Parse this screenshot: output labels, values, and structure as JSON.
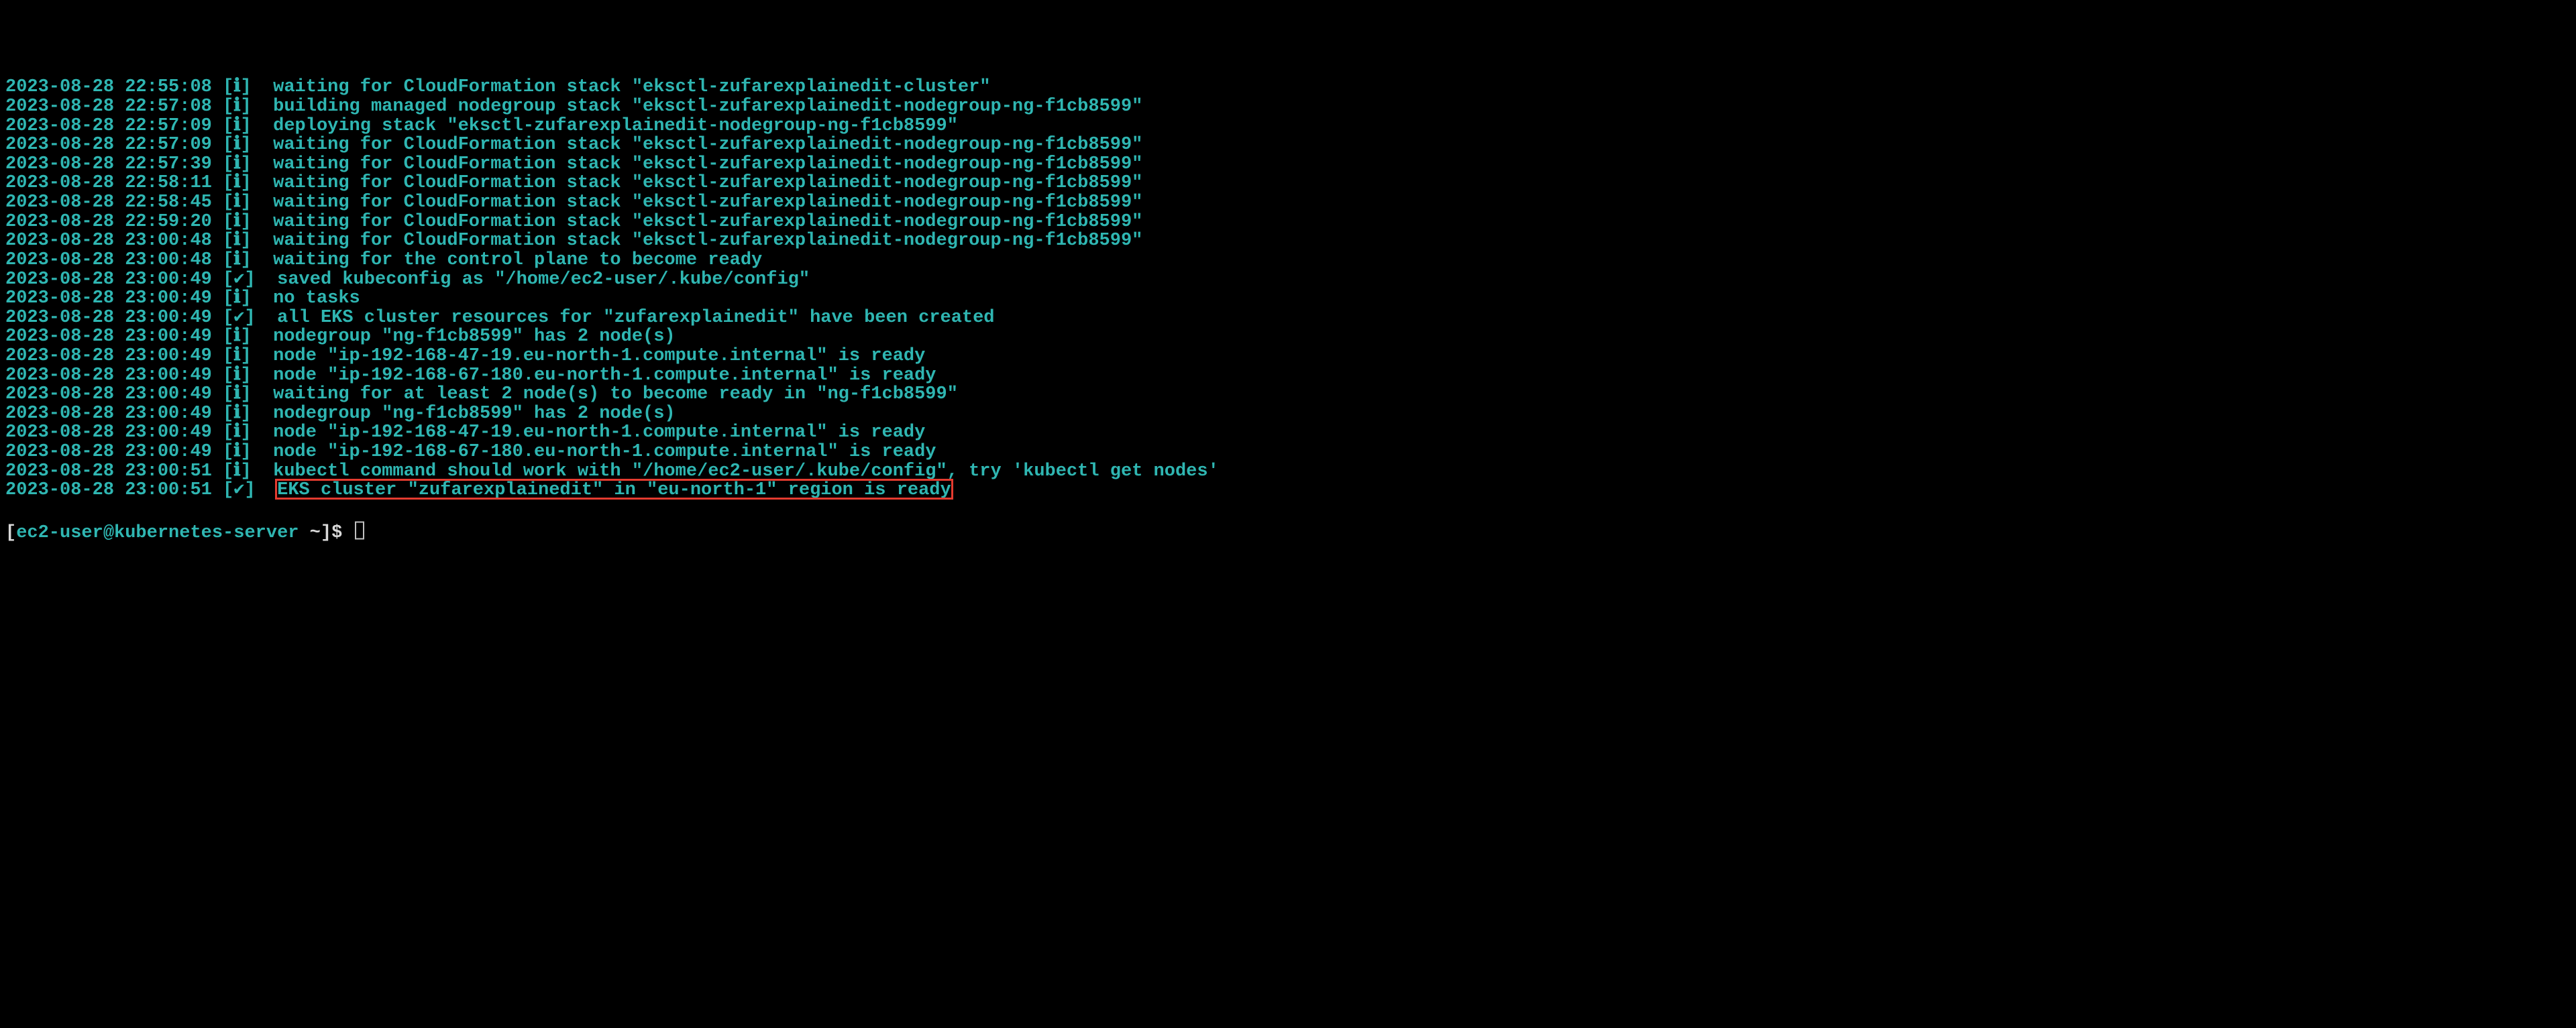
{
  "lines": [
    {
      "timestamp": "2023-08-28 22:55:08",
      "flag": "[ℹ]",
      "message": "waiting for CloudFormation stack \"eksctl-zufarexplainedit-cluster\""
    },
    {
      "timestamp": "2023-08-28 22:57:08",
      "flag": "[ℹ]",
      "message": "building managed nodegroup stack \"eksctl-zufarexplainedit-nodegroup-ng-f1cb8599\""
    },
    {
      "timestamp": "2023-08-28 22:57:09",
      "flag": "[ℹ]",
      "message": "deploying stack \"eksctl-zufarexplainedit-nodegroup-ng-f1cb8599\""
    },
    {
      "timestamp": "2023-08-28 22:57:09",
      "flag": "[ℹ]",
      "message": "waiting for CloudFormation stack \"eksctl-zufarexplainedit-nodegroup-ng-f1cb8599\""
    },
    {
      "timestamp": "2023-08-28 22:57:39",
      "flag": "[ℹ]",
      "message": "waiting for CloudFormation stack \"eksctl-zufarexplainedit-nodegroup-ng-f1cb8599\""
    },
    {
      "timestamp": "2023-08-28 22:58:11",
      "flag": "[ℹ]",
      "message": "waiting for CloudFormation stack \"eksctl-zufarexplainedit-nodegroup-ng-f1cb8599\""
    },
    {
      "timestamp": "2023-08-28 22:58:45",
      "flag": "[ℹ]",
      "message": "waiting for CloudFormation stack \"eksctl-zufarexplainedit-nodegroup-ng-f1cb8599\""
    },
    {
      "timestamp": "2023-08-28 22:59:20",
      "flag": "[ℹ]",
      "message": "waiting for CloudFormation stack \"eksctl-zufarexplainedit-nodegroup-ng-f1cb8599\""
    },
    {
      "timestamp": "2023-08-28 23:00:48",
      "flag": "[ℹ]",
      "message": "waiting for CloudFormation stack \"eksctl-zufarexplainedit-nodegroup-ng-f1cb8599\""
    },
    {
      "timestamp": "2023-08-28 23:00:48",
      "flag": "[ℹ]",
      "message": "waiting for the control plane to become ready"
    },
    {
      "timestamp": "2023-08-28 23:00:49",
      "flag": "[✔]",
      "message": "saved kubeconfig as \"/home/ec2-user/.kube/config\""
    },
    {
      "timestamp": "2023-08-28 23:00:49",
      "flag": "[ℹ]",
      "message": "no tasks"
    },
    {
      "timestamp": "2023-08-28 23:00:49",
      "flag": "[✔]",
      "message": "all EKS cluster resources for \"zufarexplainedit\" have been created"
    },
    {
      "timestamp": "2023-08-28 23:00:49",
      "flag": "[ℹ]",
      "message": "nodegroup \"ng-f1cb8599\" has 2 node(s)"
    },
    {
      "timestamp": "2023-08-28 23:00:49",
      "flag": "[ℹ]",
      "message": "node \"ip-192-168-47-19.eu-north-1.compute.internal\" is ready"
    },
    {
      "timestamp": "2023-08-28 23:00:49",
      "flag": "[ℹ]",
      "message": "node \"ip-192-168-67-180.eu-north-1.compute.internal\" is ready"
    },
    {
      "timestamp": "2023-08-28 23:00:49",
      "flag": "[ℹ]",
      "message": "waiting for at least 2 node(s) to become ready in \"ng-f1cb8599\""
    },
    {
      "timestamp": "2023-08-28 23:00:49",
      "flag": "[ℹ]",
      "message": "nodegroup \"ng-f1cb8599\" has 2 node(s)"
    },
    {
      "timestamp": "2023-08-28 23:00:49",
      "flag": "[ℹ]",
      "message": "node \"ip-192-168-47-19.eu-north-1.compute.internal\" is ready"
    },
    {
      "timestamp": "2023-08-28 23:00:49",
      "flag": "[ℹ]",
      "message": "node \"ip-192-168-67-180.eu-north-1.compute.internal\" is ready"
    },
    {
      "timestamp": "2023-08-28 23:00:51",
      "flag": "[ℹ]",
      "message": "kubectl command should work with \"/home/ec2-user/.kube/config\", try 'kubectl get nodes'"
    },
    {
      "timestamp": "2023-08-28 23:00:51",
      "flag": "[✔]",
      "message": "EKS cluster \"zufarexplainedit\" in \"eu-north-1\" region is ready",
      "highlight": true
    }
  ],
  "prompt": {
    "open": "[",
    "user": "ec2-user",
    "at": "@",
    "host": "kubernetes-server",
    "tail": " ~]$ "
  }
}
